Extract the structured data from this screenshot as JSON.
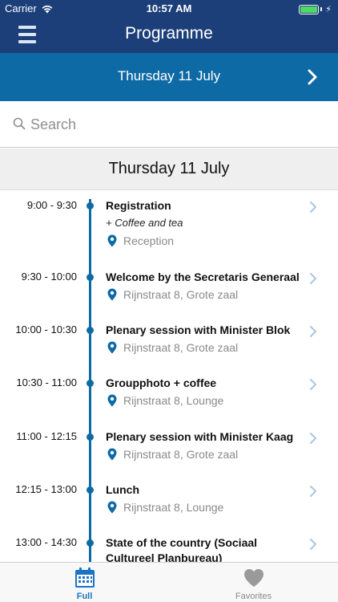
{
  "status_bar": {
    "carrier": "Carrier",
    "time": "10:57 AM",
    "battery_level": 1.0
  },
  "nav": {
    "title": "Programme",
    "menu_icon": "hamburger-menu-icon"
  },
  "date_selector": {
    "label": "Thursday 11 July",
    "next_icon": "chevron-right-icon"
  },
  "search": {
    "placeholder": "Search",
    "value": ""
  },
  "day_header": {
    "label": "Thursday 11 July"
  },
  "colors": {
    "nav_bg": "#1c3f7a",
    "date_bar_bg": "#0e6aa5",
    "timeline": "#0e6aa5",
    "tab_active": "#1a73c4"
  },
  "sessions": [
    {
      "time": "9:00 - 9:30",
      "title": "Registration",
      "subtitle": "+ Coffee and tea",
      "location": "Reception"
    },
    {
      "time": "9:30 - 10:00",
      "title": "Welcome by the Secretaris Generaal",
      "location": "Rijnstraat 8, Grote zaal"
    },
    {
      "time": "10:00 - 10:30",
      "title": "Plenary session with Minister Blok",
      "location": "Rijnstraat 8, Grote zaal"
    },
    {
      "time": "10:30 - 11:00",
      "title": "Groupphoto + coffee",
      "location": "Rijnstraat 8, Lounge"
    },
    {
      "time": "11:00 - 12:15",
      "title": "Plenary session with Minister Kaag",
      "location": "Rijnstraat 8, Grote zaal"
    },
    {
      "time": "12:15 - 13:00",
      "title": "Lunch",
      "location": "Rijnstraat 8, Lounge"
    },
    {
      "time": "13:00 - 14:30",
      "title": "State of the country (Sociaal Cultureel Planbureau)",
      "location": ""
    }
  ],
  "tabs": [
    {
      "label": "Full",
      "icon": "calendar-icon",
      "active": true
    },
    {
      "label": "Favorites",
      "icon": "heart-icon",
      "active": false
    }
  ]
}
